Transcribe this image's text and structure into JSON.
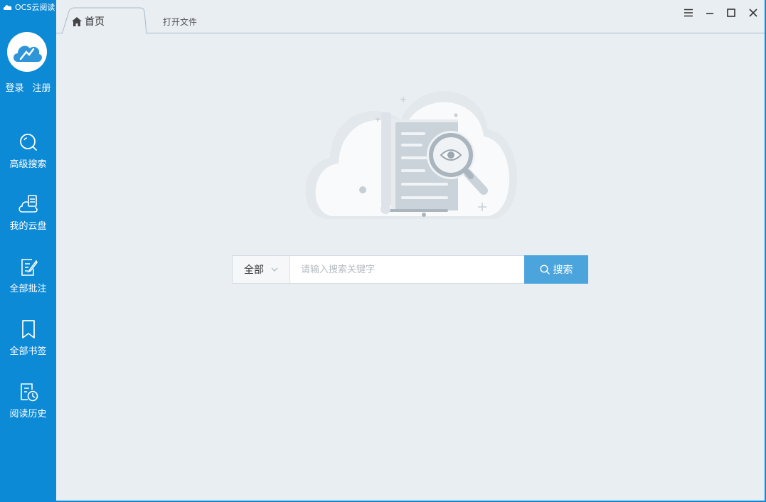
{
  "app": {
    "title": "OCS云阅读"
  },
  "auth": {
    "login": "登录",
    "register": "注册"
  },
  "sidebar": {
    "items": [
      {
        "label": "高级搜索",
        "icon": "search-icon"
      },
      {
        "label": "我的云盘",
        "icon": "cloud-drive-icon"
      },
      {
        "label": "全部批注",
        "icon": "annotation-icon"
      },
      {
        "label": "全部书签",
        "icon": "bookmark-icon"
      },
      {
        "label": "阅读历史",
        "icon": "history-icon"
      }
    ]
  },
  "tabs": [
    {
      "label": "首页",
      "active": true
    },
    {
      "label": "打开文件",
      "active": false
    }
  ],
  "search": {
    "scope": "全部",
    "placeholder": "请输入搜索关键字",
    "button": "搜索"
  },
  "colors": {
    "sidebar": "#0d8ad6",
    "accent": "#4ca4dc",
    "background": "#e9eef3"
  }
}
